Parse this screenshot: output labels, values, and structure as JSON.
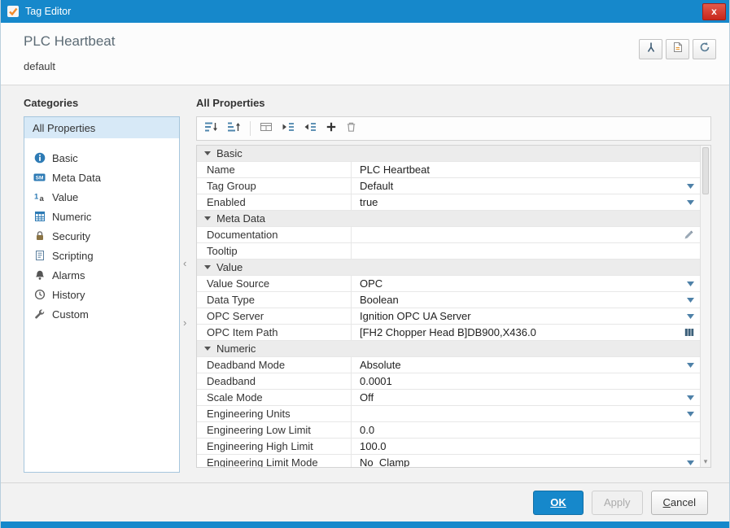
{
  "titlebar": {
    "title": "Tag Editor",
    "app_icon": "tag-check-icon",
    "close": "x"
  },
  "header": {
    "title": "PLC Heartbeat",
    "subtitle": "default",
    "buttons": [
      {
        "icon": "diagnostics-icon"
      },
      {
        "icon": "notes-icon"
      },
      {
        "icon": "refresh-icon"
      }
    ]
  },
  "categories": {
    "heading": "Categories",
    "items": [
      {
        "label": "All Properties",
        "icon": null,
        "selected": true
      },
      {
        "label": "Basic",
        "icon": "info-icon"
      },
      {
        "label": "Meta Data",
        "icon": "metadata-icon"
      },
      {
        "label": "Value",
        "icon": "value-icon"
      },
      {
        "label": "Numeric",
        "icon": "numeric-grid-icon"
      },
      {
        "label": "Security",
        "icon": "lock-icon"
      },
      {
        "label": "Scripting",
        "icon": "script-icon"
      },
      {
        "label": "Alarms",
        "icon": "bell-icon"
      },
      {
        "label": "History",
        "icon": "clock-icon"
      },
      {
        "label": "Custom",
        "icon": "wrench-icon"
      }
    ]
  },
  "properties": {
    "heading": "All Properties",
    "toolbar": [
      "sort-ascending-icon",
      "sort-descending-icon",
      "category-view-icon",
      "expand-all-icon",
      "collapse-all-icon",
      "add-property-icon",
      "delete-icon"
    ],
    "sections": [
      {
        "name": "Basic",
        "rows": [
          {
            "property": "Name",
            "value": "PLC Heartbeat",
            "control": "text"
          },
          {
            "property": "Tag Group",
            "value": "Default",
            "control": "dropdown"
          },
          {
            "property": "Enabled",
            "value": "true",
            "control": "dropdown"
          }
        ]
      },
      {
        "name": "Meta Data",
        "rows": [
          {
            "property": "Documentation",
            "value": "",
            "control": "edit"
          },
          {
            "property": "Tooltip",
            "value": "",
            "control": "text"
          }
        ]
      },
      {
        "name": "Value",
        "rows": [
          {
            "property": "Value Source",
            "value": "OPC",
            "control": "dropdown"
          },
          {
            "property": "Data Type",
            "value": "Boolean",
            "control": "dropdown"
          },
          {
            "property": "OPC Server",
            "value": "Ignition OPC UA Server",
            "control": "dropdown"
          },
          {
            "property": "OPC Item Path",
            "value": "[FH2 Chopper Head B]DB900,X436.0",
            "control": "browse"
          }
        ]
      },
      {
        "name": "Numeric",
        "rows": [
          {
            "property": "Deadband Mode",
            "value": "Absolute",
            "control": "dropdown"
          },
          {
            "property": "Deadband",
            "value": "0.0001",
            "control": "text"
          },
          {
            "property": "Scale Mode",
            "value": "Off",
            "control": "dropdown"
          },
          {
            "property": "Engineering Units",
            "value": "",
            "control": "dropdown"
          },
          {
            "property": "Engineering Low Limit",
            "value": "0.0",
            "control": "text"
          },
          {
            "property": "Engineering High Limit",
            "value": "100.0",
            "control": "text"
          },
          {
            "property": "Engineering Limit Mode",
            "value": "No_Clamp",
            "control": "dropdown"
          }
        ]
      }
    ]
  },
  "footer": {
    "ok": "OK",
    "apply": "Apply",
    "cancel": "Cancel"
  },
  "colors": {
    "titlebar": "#1688cb",
    "accent": "#1688cb",
    "close_button": "#c7271c",
    "selection": "#d7e9f7"
  }
}
